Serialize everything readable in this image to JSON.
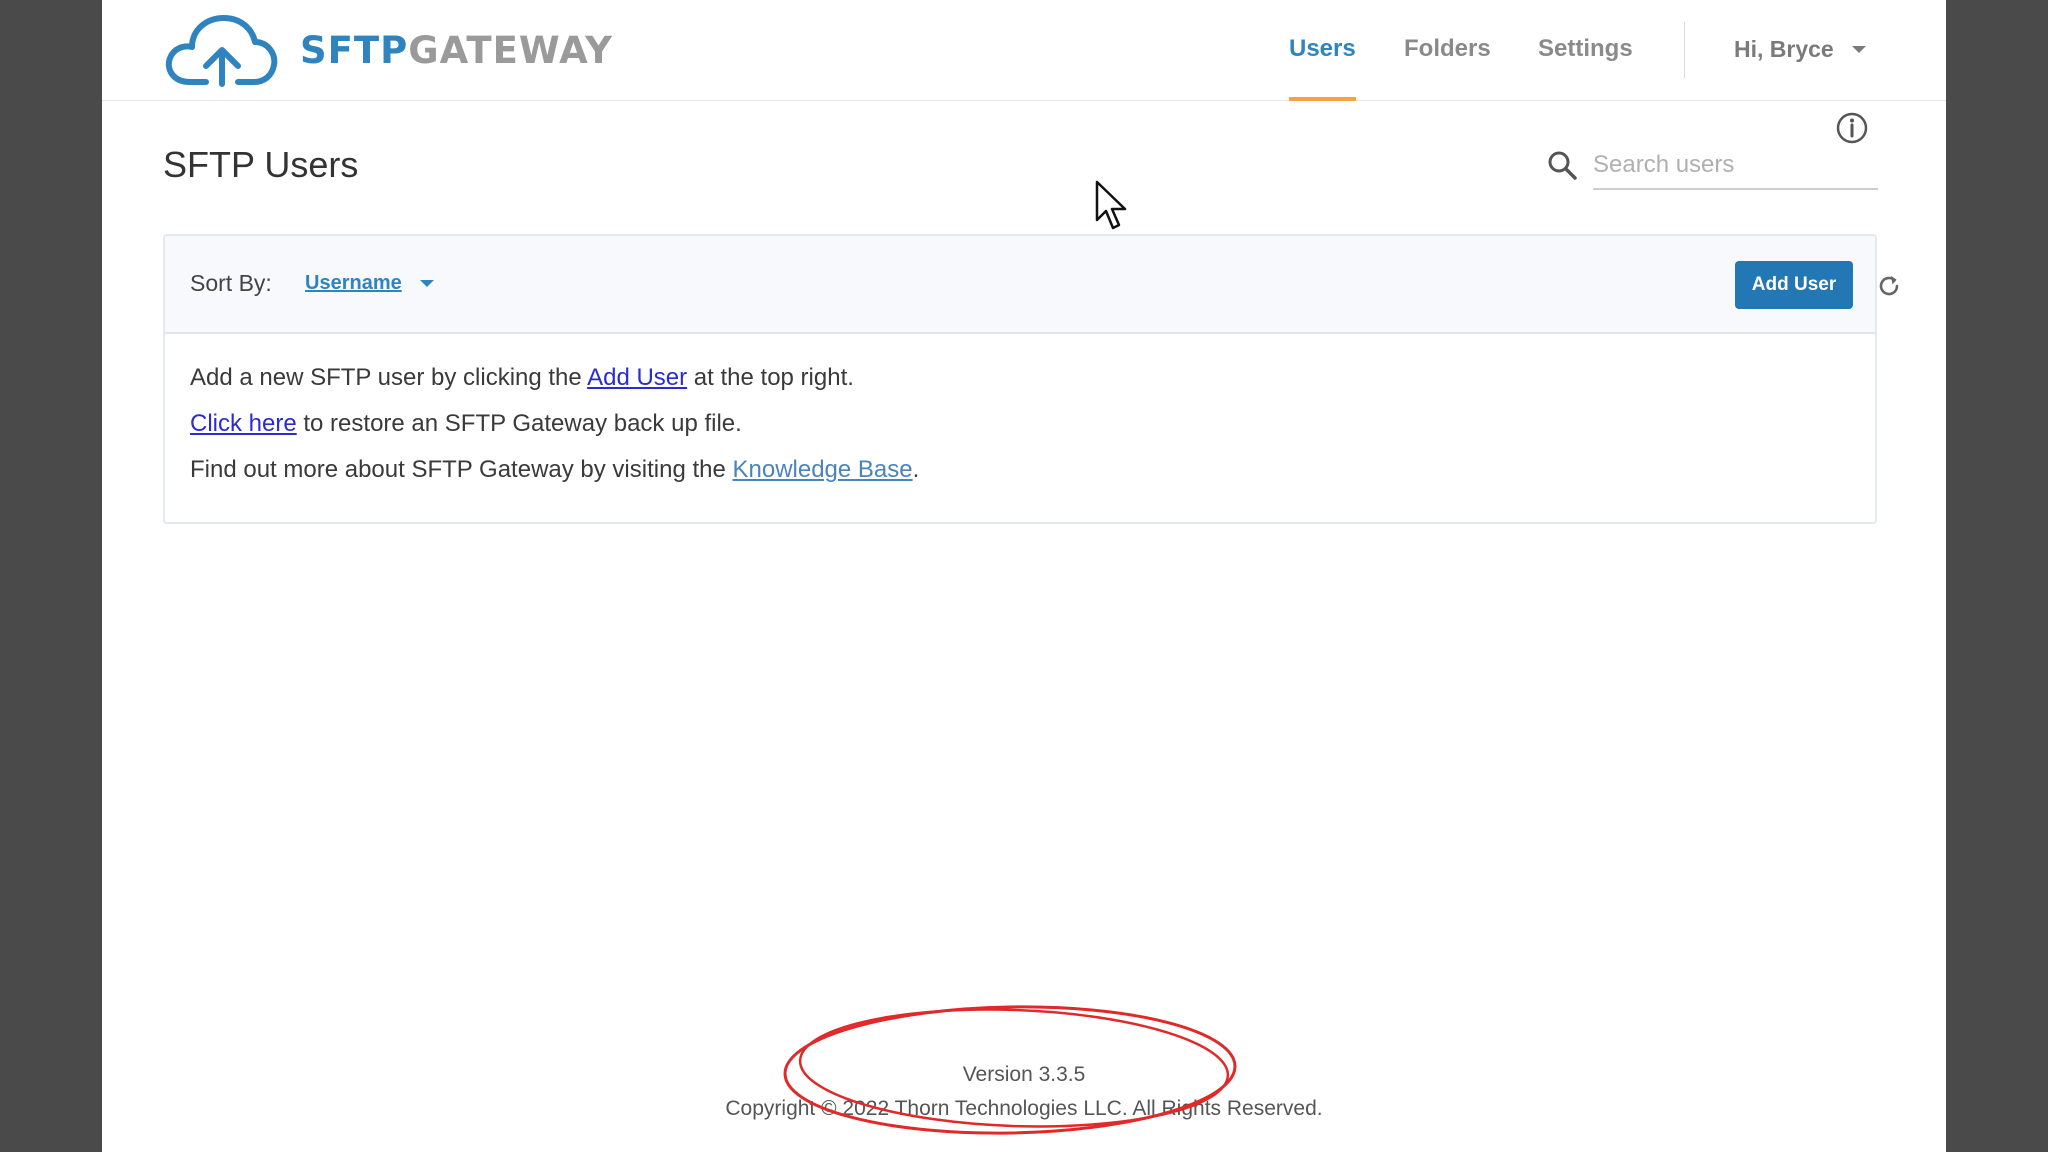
{
  "brand": {
    "name_part1": "SFTP",
    "name_part2": "GATEWAY",
    "color_primary": "#2f84c0",
    "color_secondary": "#9a9a9a"
  },
  "nav": {
    "tabs": [
      {
        "label": "Users",
        "active": true
      },
      {
        "label": "Folders",
        "active": false
      },
      {
        "label": "Settings",
        "active": false
      }
    ],
    "user_greeting": "Hi, Bryce",
    "accent_color": "#f4a342"
  },
  "page": {
    "title": "SFTP Users",
    "search_placeholder": "Search users"
  },
  "toolbar": {
    "sort_label": "Sort By:",
    "sort_value": "Username",
    "add_user_label": "Add User"
  },
  "messages": {
    "line1_pre": "Add a new SFTP user by clicking the ",
    "line1_link": "Add User",
    "line1_post": " at the top right.",
    "line2_link": "Click here",
    "line2_post": " to restore an SFTP Gateway back up file.",
    "line3_pre": "Find out more about SFTP Gateway by visiting the ",
    "line3_link": "Knowledge Base",
    "line3_post": "."
  },
  "footer": {
    "version": "Version 3.3.5",
    "copyright": "Copyright © 2022 Thorn Technologies LLC. All Rights Reserved."
  }
}
